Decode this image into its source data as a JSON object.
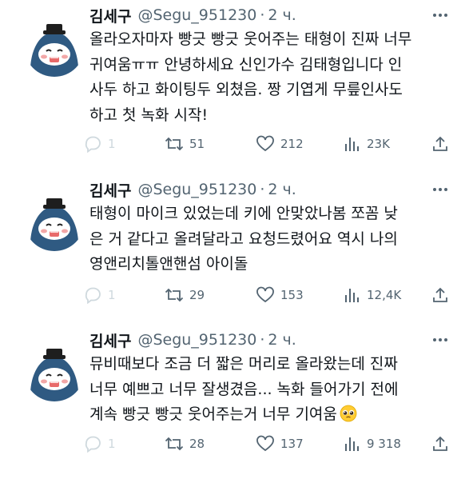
{
  "tweets": [
    {
      "author": {
        "name": "김세구",
        "handle": "@Segu_951230",
        "separator": "·",
        "time": "2 ч."
      },
      "text_lines": [
        "올라오자마자 빵긋 빵긋 웃어주는 태형이 진짜 너무",
        "귀여움ㅠㅠ 안녕하세요 신인가수 김태형입니다 인",
        "사두 하고 화이팅두 외쳤음. 짱 기엽게 무릎인사도",
        "하고 첫 녹화 시작!"
      ],
      "stats": {
        "replies": "1",
        "reposts": "51",
        "likes": "212",
        "views": "23K"
      }
    },
    {
      "author": {
        "name": "김세구",
        "handle": "@Segu_951230",
        "separator": "·",
        "time": "2 ч."
      },
      "text_lines": [
        "태형이 마이크 있었는데 키에 안맞았나봄 쪼꼼 낮",
        "은 거 같다고 올려달라고 요청드렸어요 역시 나의",
        "영앤리치톨앤핸섬 아이돌"
      ],
      "stats": {
        "replies": "1",
        "reposts": "29",
        "likes": "153",
        "views": "12,4K"
      }
    },
    {
      "author": {
        "name": "김세구",
        "handle": "@Segu_951230",
        "separator": "·",
        "time": "2 ч."
      },
      "text_lines": [
        "뮤비때보다 조금 더 짧은 머리로 올라왔는데 진짜",
        "너무 예쁘고 너무 잘생겼음... 녹화 들어가기 전에",
        "계속 빵긋 빵긋 웃어주는거 너무 기여움"
      ],
      "trailing_emoji": "pleading-face-emoji",
      "stats": {
        "replies": "1",
        "reposts": "28",
        "likes": "137",
        "views": "9 318"
      }
    }
  ],
  "icons": {
    "more": "more-icon",
    "reply": "reply-icon",
    "repost": "repost-icon",
    "like": "like-icon",
    "views": "views-icon",
    "share": "share-icon"
  },
  "colors": {
    "text": "#0f1419",
    "secondary": "#536471",
    "reply_icon": "#cfd9de",
    "avatar_body": "#2f5a82",
    "avatar_face": "#ffffff",
    "avatar_cheek": "#f2a7a7"
  }
}
